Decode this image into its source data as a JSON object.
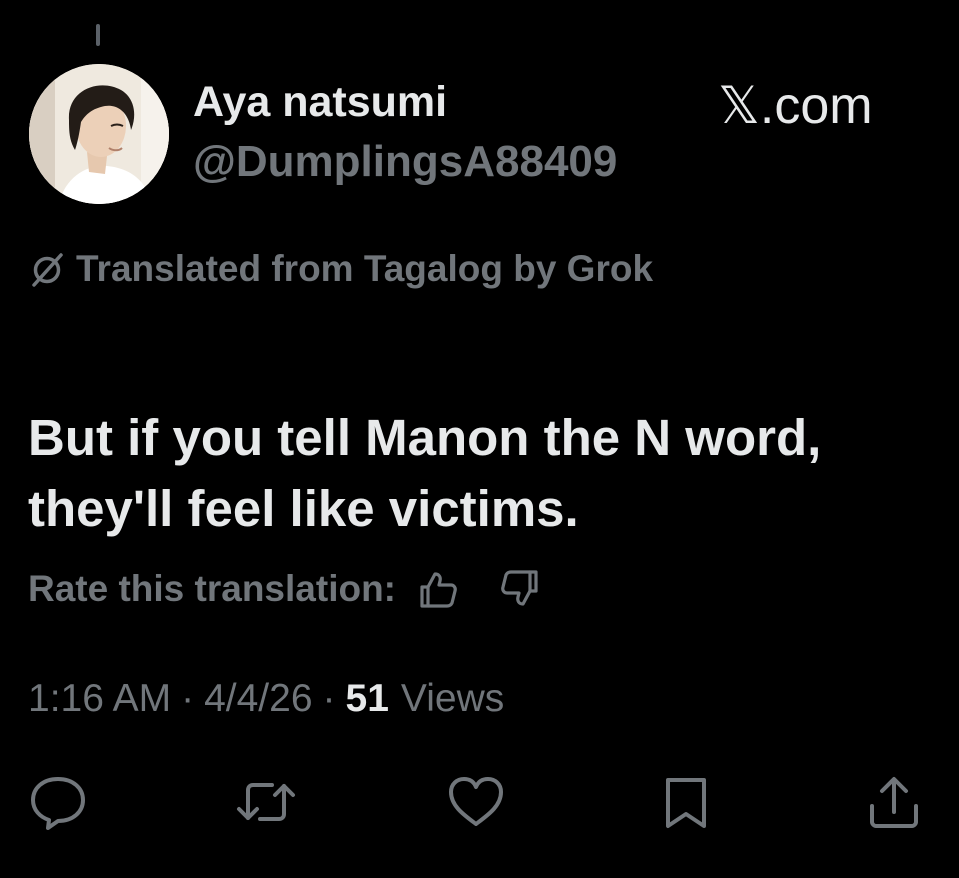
{
  "author": {
    "display_name": "Aya natsumi",
    "handle": "@DumplingsA88409",
    "avatar_icon": "profile-photo"
  },
  "watermark": "𝕏.com",
  "translation": {
    "notice": "Translated from Tagalog by Grok",
    "notice_icon": "grok-icon",
    "rate_label": "Rate this translation:",
    "rate_icons": [
      "thumbs-up-icon",
      "thumbs-down-icon"
    ]
  },
  "post": {
    "text_lines": [
      "But if you tell Manon the N word,",
      "they'll feel like victims."
    ]
  },
  "meta": {
    "time": "1:16 AM",
    "separator": "·",
    "date": "4/4/26",
    "views_count": "51",
    "views_label": "Views"
  },
  "actions": [
    {
      "icon": "reply-icon"
    },
    {
      "icon": "repost-icon"
    },
    {
      "icon": "like-icon"
    },
    {
      "icon": "bookmark-icon"
    },
    {
      "icon": "share-icon"
    }
  ],
  "colors": {
    "background": "#000000",
    "primary_text": "#e7e9ea",
    "secondary_text": "#71767b"
  }
}
